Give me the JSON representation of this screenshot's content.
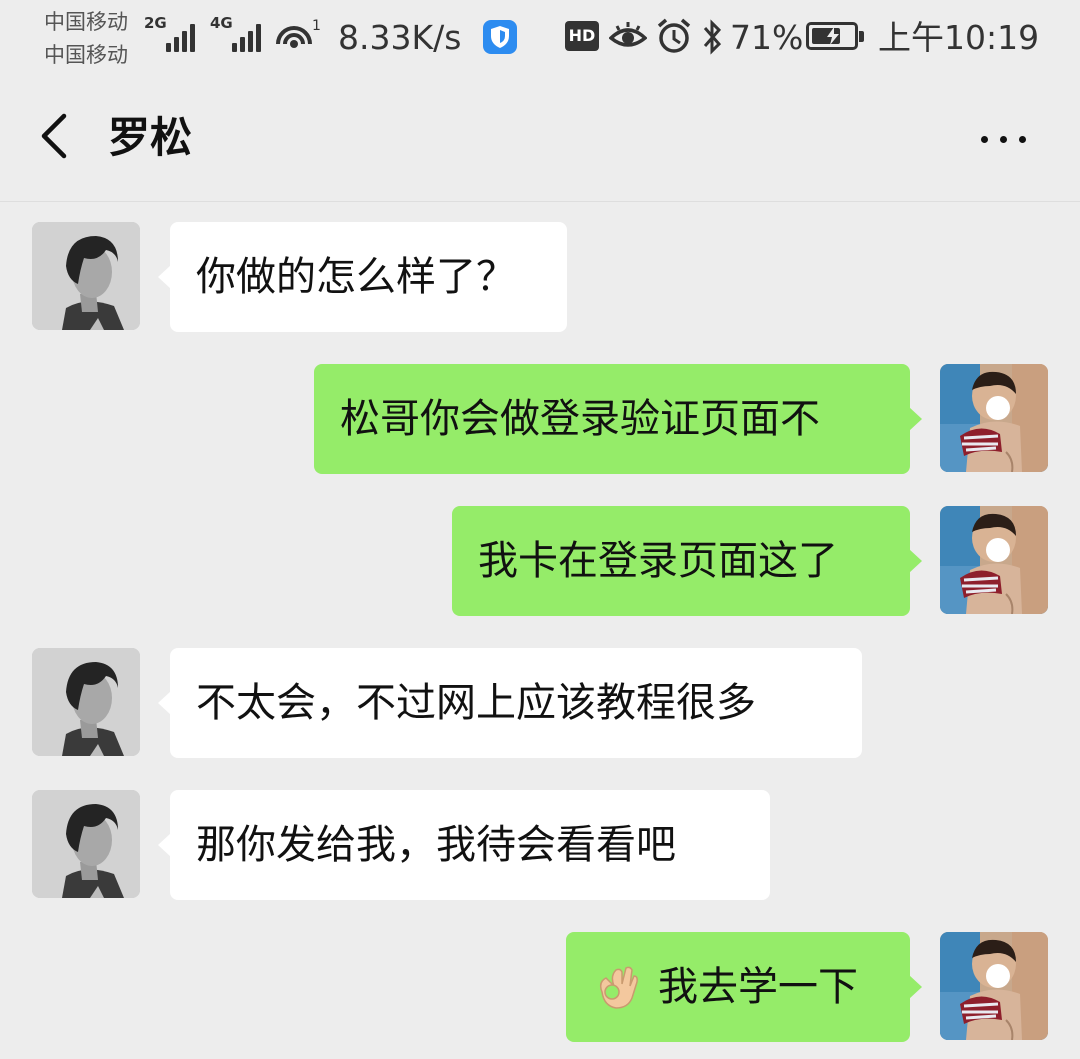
{
  "status_bar": {
    "carrier_1": "中国移动",
    "carrier_2": "中国移动",
    "signal_1_tag": "2G",
    "signal_2_tag": "4G",
    "hotspot_badge": "1",
    "net_speed": "8.33K/s",
    "hd_badge": "HD",
    "battery": "71%",
    "battery_level": 0.71,
    "time": "上午10:19"
  },
  "header": {
    "title": "罗松",
    "back_icon": "chevron-left-icon",
    "more_icon": "more-dots-icon"
  },
  "messages": [
    {
      "sender": "contact",
      "text": "你做的怎么样了？"
    },
    {
      "sender": "me",
      "text": "松哥你会做登录验证页面不"
    },
    {
      "sender": "me",
      "text": "我卡在登录页面这了"
    },
    {
      "sender": "contact",
      "text": "不太会，不过网上应该教程很多"
    },
    {
      "sender": "contact",
      "text": "那你发给我，我待会看看吧"
    },
    {
      "sender": "me",
      "emoji": "ok-hand-emoji",
      "text": "我去学一下"
    }
  ],
  "colors": {
    "background": "#ededed",
    "incoming_bubble": "#ffffff",
    "outgoing_bubble": "#95ec69",
    "text": "#111111"
  }
}
